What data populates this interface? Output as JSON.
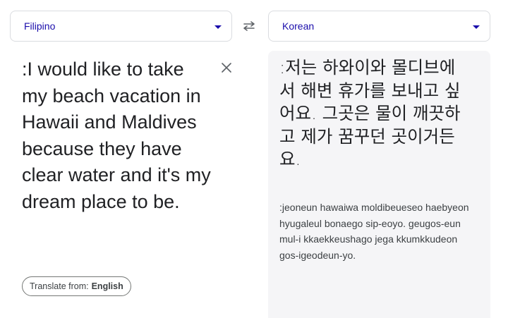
{
  "source_language": {
    "label": "Filipino"
  },
  "target_language": {
    "label": "Korean"
  },
  "source": {
    "text": ":I would like to take my beach vacation in Hawaii and Maldives because they have clear water and it's my dream place to be.",
    "translate_from_prefix": "Translate from:",
    "translate_from_lang": "English"
  },
  "target": {
    "text": ":저는 하와이와 몰디브에서 해변 휴가를 보내고 싶어요. 그곳은 물이 깨끗하고 제가 꿈꾸던 곳이거든요.",
    "romanization": ":jeoneun hawaiwa moldibeueseo haebyeon hyugaleul bonaego sip-eoyo. geugos-eun mul-i kkaekkeushago jega kkumkkudeon gos-igeodeun-yo."
  },
  "icons": {
    "swap": "swap-arrows-icon",
    "clear": "close-icon",
    "dropdown": "chevron-down-icon"
  },
  "colors": {
    "accent": "#1a0dab",
    "target_bg": "#f5f5f7",
    "border": "#dadce0"
  }
}
